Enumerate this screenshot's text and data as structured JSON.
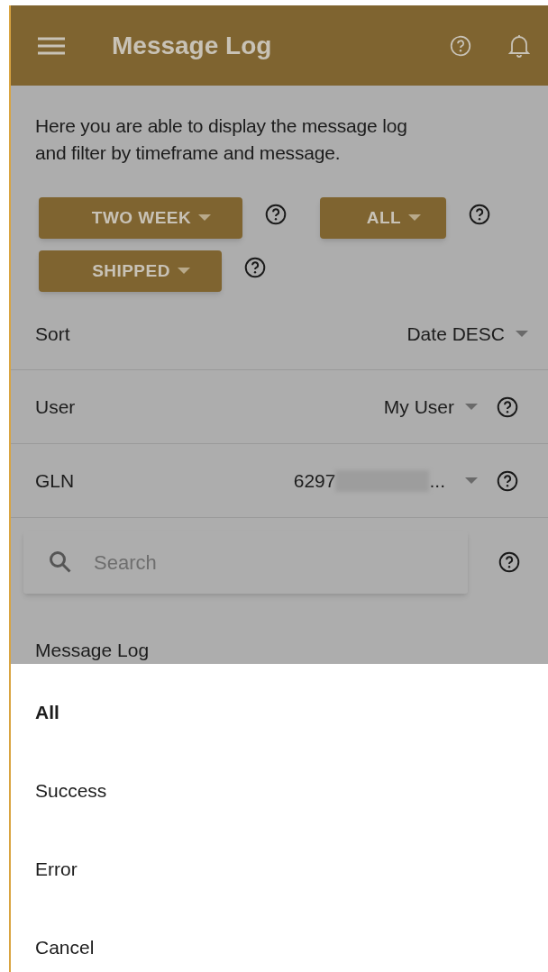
{
  "app_bar": {
    "title": "Message Log"
  },
  "description": "Here you are able to display the message log and filter by timeframe and message.",
  "filter_buttons": [
    {
      "label": "TWO WEEK"
    },
    {
      "label": "ALL"
    },
    {
      "label": "SHIPPED"
    }
  ],
  "settings": [
    {
      "kind": "select",
      "label": "Sort",
      "value": "Date DESC",
      "help": false
    },
    {
      "kind": "select",
      "label": "User",
      "value": "My User",
      "help": true
    },
    {
      "kind": "redacted",
      "label": "GLN",
      "value": "6297",
      "suffix": "...",
      "help": true
    }
  ],
  "search": {
    "placeholder": "Search"
  },
  "section_title": "Message Log",
  "sheet_options": [
    {
      "label": "All",
      "selected": true
    },
    {
      "label": "Success",
      "selected": false
    },
    {
      "label": "Error",
      "selected": false
    },
    {
      "label": "Cancel",
      "selected": false
    }
  ]
}
